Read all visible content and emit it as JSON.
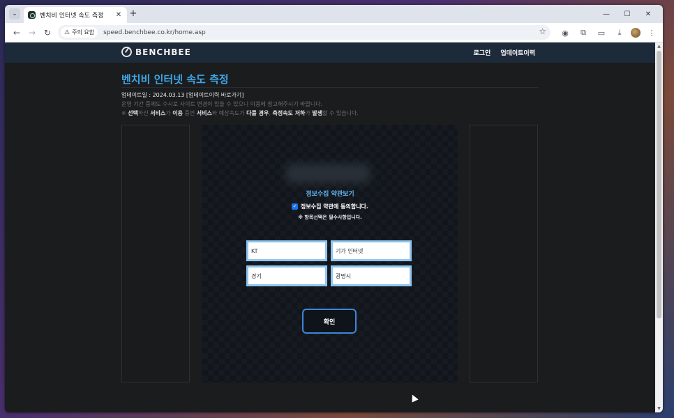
{
  "browser": {
    "tab_title": "벤치비 인터넷 속도 측정",
    "security_label": "주의 요함",
    "url": "speed.benchbee.co.kr/home.asp"
  },
  "site": {
    "logo_text": "BENCHBEE",
    "nav": [
      "로그인",
      "업데이트이력"
    ],
    "page_title": "벤치비 인터넷 속도 측정",
    "update_line": "업데이트일 : 2024.03.13 [업데이트이력 바로가기]",
    "notice_1": "운영 기간 중에도 수시로 사이트 변경이 있을 수 있으니 이용에 참고해주시기 바랍니다.",
    "notice_2": {
      "p0": "※ ",
      "b1": "선택",
      "p1": "하신 ",
      "b2": "서비스",
      "p2": "가 ",
      "b3": "이용",
      "p3": " 중인 ",
      "b4": "서비스",
      "p4": "와 예상속도가 ",
      "b5": "다를 경우",
      "p5": ", ",
      "b6": "측정속도 저하",
      "p6": "가 ",
      "b7": "발생",
      "p7": "할 수 있습니다."
    }
  },
  "form": {
    "terms_link": "정보수집 약관보기",
    "agree_label": "정보수집 약관에 동의합니다.",
    "agree_checked": true,
    "required_note": "※ 항목선택은 필수사항입니다.",
    "isp": "KT",
    "plan": "기가 인터넷",
    "region": "경기",
    "city": "광명시",
    "confirm_label": "확인"
  },
  "colors": {
    "accent": "#3ea7e8",
    "header_bg": "#1d2a3a",
    "field_border": "#8fc6ef",
    "button_border": "#3e86d9"
  }
}
